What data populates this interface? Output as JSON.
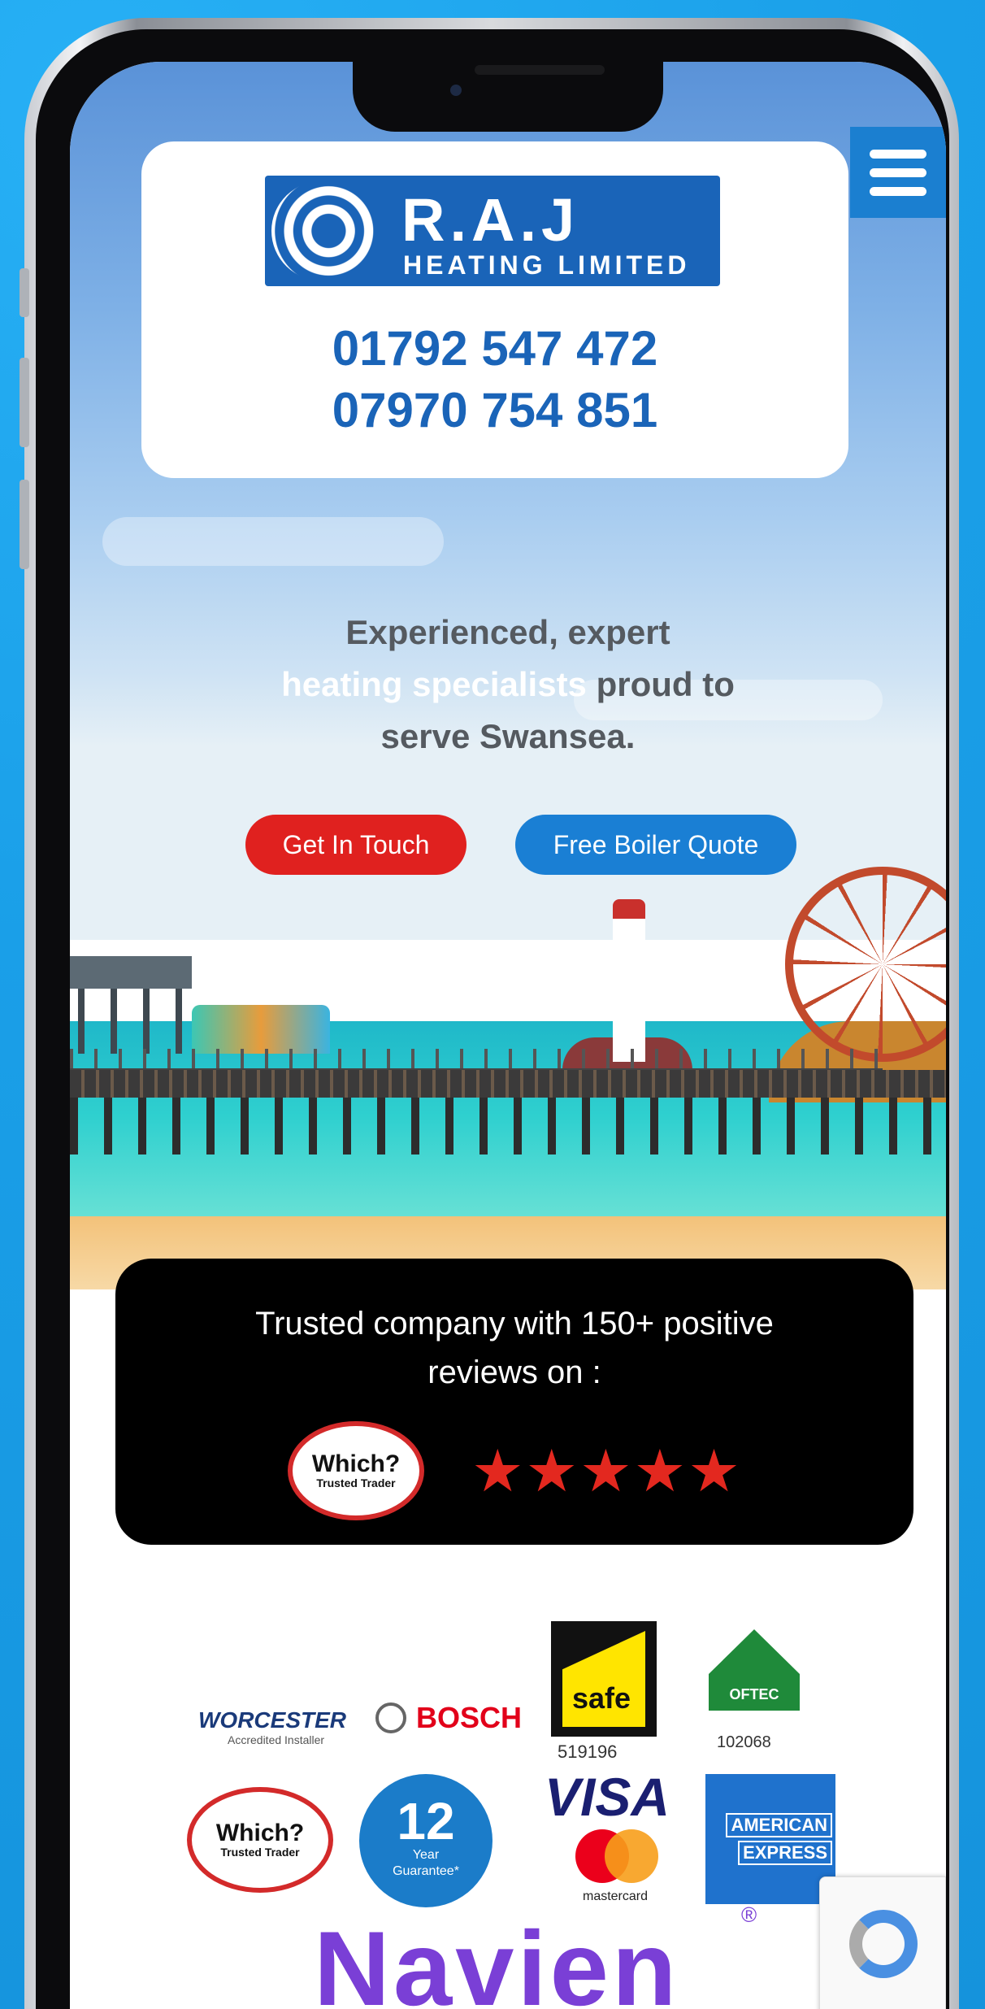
{
  "header": {
    "logo_name": "R.A.J",
    "logo_sub": "HEATING LIMITED",
    "phone_1": "01792 547 472",
    "phone_2": "07970 754 851"
  },
  "hero": {
    "tagline_1": "Experienced, expert",
    "tagline_2_highlight": "heating specialists",
    "tagline_2_rest": " proud to",
    "tagline_3": "serve Swansea.",
    "cta_contact": "Get In Touch",
    "cta_quote": "Free Boiler Quote"
  },
  "reviews": {
    "text_1": "Trusted company with 150+ positive",
    "text_2": "reviews on :",
    "badge_main": "Which?",
    "badge_sub": "Trusted Trader",
    "stars": "★★★★★",
    "rating": 5
  },
  "accreditations": {
    "worcester": "WORCESTER",
    "worcester_sub": "Accredited Installer",
    "bosch": "BOSCH",
    "gas_safe": "safe",
    "gas_safe_number": "519196",
    "oftec": "OFTEC",
    "oftec_number": "102068",
    "which_main": "Which?",
    "which_sub": "Trusted Trader",
    "guarantee_years": "12",
    "guarantee_line1": "Year",
    "guarantee_line2": "Guarantee*",
    "visa": "VISA",
    "mastercard": "mastercard",
    "amex_line1": "AMERICAN",
    "amex_line2": "EXPRESS",
    "navien": "Navien",
    "navien_reg": "®"
  },
  "colors": {
    "brand_blue": "#1a64b8",
    "cta_red": "#e0211f",
    "cta_blue": "#1a7fd4",
    "star_red": "#e3281f"
  }
}
